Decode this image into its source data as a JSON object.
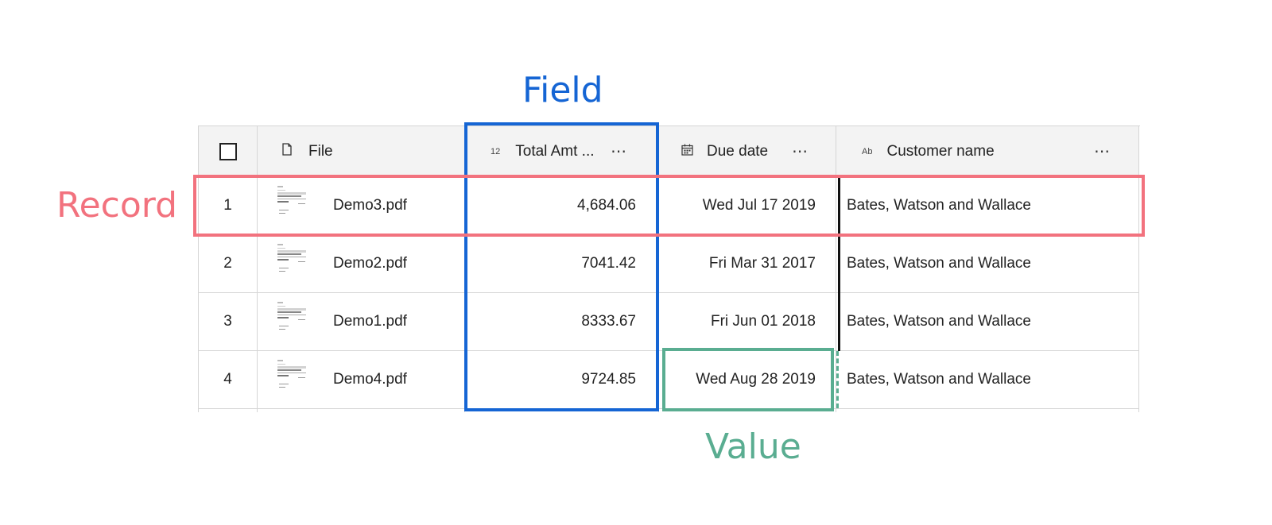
{
  "annotations": {
    "field": "Field",
    "record": "Record",
    "value": "Value"
  },
  "colors": {
    "field": "#1565d4",
    "record": "#f2727e",
    "value": "#5aad91"
  },
  "table": {
    "columns": [
      {
        "label": "",
        "icon": "checkbox-icon"
      },
      {
        "label": "File",
        "icon": "file-icon"
      },
      {
        "label": "Total Amt ...",
        "icon": "number-type-icon",
        "icon_text": "12",
        "more": "⋯"
      },
      {
        "label": "Due date",
        "icon": "calendar-icon",
        "more": "⋯"
      },
      {
        "label": "Customer name",
        "icon": "text-type-icon",
        "icon_text": "Ab",
        "more": "⋯"
      }
    ],
    "rows": [
      {
        "index": "1",
        "file": "Demo3.pdf",
        "total": "4,684.06",
        "due": "Wed Jul 17 2019",
        "customer": "Bates, Watson and Wallace"
      },
      {
        "index": "2",
        "file": "Demo2.pdf",
        "total": "7041.42",
        "due": "Fri Mar 31 2017",
        "customer": "Bates, Watson and Wallace"
      },
      {
        "index": "3",
        "file": "Demo1.pdf",
        "total": "8333.67",
        "due": "Fri Jun 01 2018",
        "customer": "Bates, Watson and Wallace"
      },
      {
        "index": "4",
        "file": "Demo4.pdf",
        "total": "9724.85",
        "due": "Wed Aug 28 2019",
        "customer": "Bates, Watson and Wallace"
      }
    ]
  }
}
